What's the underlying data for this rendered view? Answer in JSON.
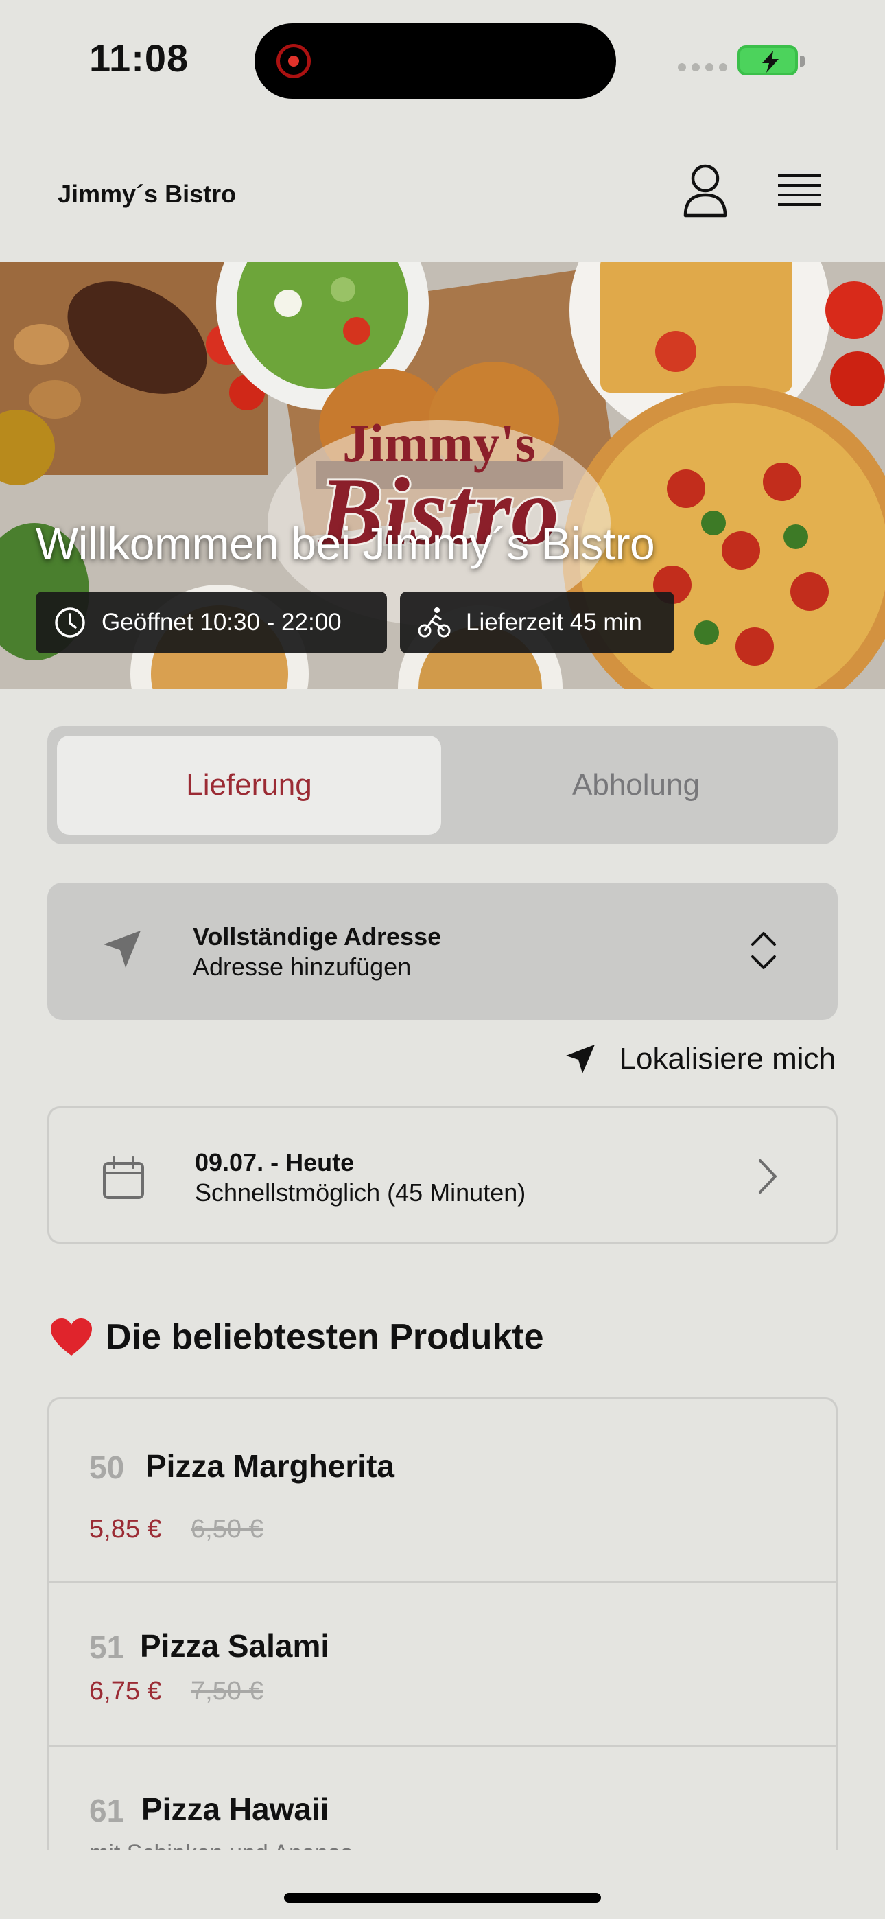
{
  "status_bar": {
    "time": "11:08"
  },
  "header": {
    "brand": "Jimmy´s Bistro"
  },
  "hero": {
    "title": "Willkommen bei Jimmy´s Bistro",
    "logo_text_1": "Jimmy's",
    "logo_text_2": "Bistro",
    "opening_hours": "Geöffnet 10:30 - 22:00",
    "delivery_time": "Lieferzeit 45 min"
  },
  "order_mode": {
    "delivery_label": "Lieferung",
    "pickup_label": "Abholung",
    "selected": "Lieferung"
  },
  "address": {
    "title": "Vollständige Adresse",
    "subtitle": "Adresse hinzufügen"
  },
  "locate_me": "Lokalisiere mich",
  "schedule": {
    "date": "09.07. - Heute",
    "time": "Schnellstmöglich (45 Minuten)"
  },
  "popular": {
    "title": "Die beliebtesten Produkte",
    "icon": "heart-icon",
    "items": [
      {
        "number": "50",
        "name": "Pizza Margherita",
        "price": "5,85 €",
        "old_price": "6,50 €"
      },
      {
        "number": "51",
        "name": "Pizza Salami",
        "price": "6,75 €",
        "old_price": "7,50 €"
      },
      {
        "number": "61",
        "name": "Pizza Hawaii",
        "description": "mit Schinken und Ananas"
      }
    ]
  },
  "colors": {
    "accent": "#9b2b34",
    "background": "#e4e4e0",
    "battery": "#4cd35c"
  }
}
